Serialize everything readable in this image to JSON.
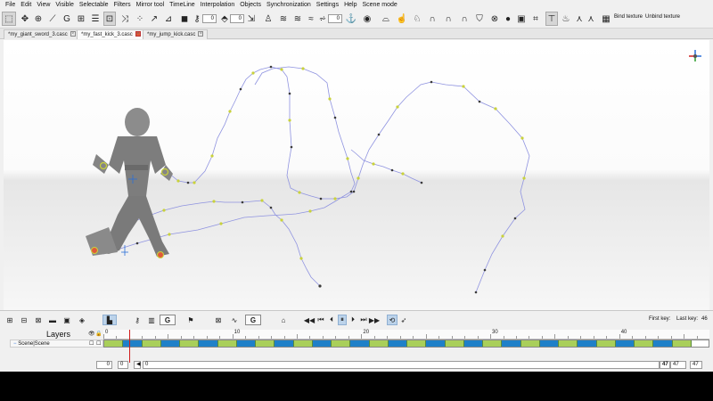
{
  "menu": [
    "File",
    "Edit",
    "View",
    "Visible",
    "Selectable",
    "Filters",
    "Mirror tool",
    "TimeLine",
    "Interpolation",
    "Objects",
    "Synchronization",
    "Settings",
    "Help",
    "Scene mode"
  ],
  "toolbar": {
    "field_a": "0",
    "field_b": "0",
    "field_c": "0",
    "bind_texture": "Bind texture",
    "unbind_texture": "Unbind texture"
  },
  "tabs": [
    {
      "label": "*my_giant_sword_3.casc",
      "active": false
    },
    {
      "label": "*my_fast_kick_3.casc",
      "active": true
    },
    {
      "label": "*my_jump_kick.casc",
      "active": false
    }
  ],
  "timeline": {
    "first_key_label": "First key:",
    "first_key_value": "",
    "last_key_label": "Last key:",
    "last_key_value": "46",
    "layers_title": "Layers",
    "layer_name": "Scene|Scene",
    "ruler_labels": [
      "0",
      "10",
      "20",
      "30",
      "40"
    ],
    "current_frame": 2,
    "frame_count": 47,
    "bottom_left_a": "0",
    "bottom_left_b": "0",
    "bottom_mid": "0",
    "bottom_right_a": "47",
    "bottom_right_b": "47",
    "bottom_right_c": "47",
    "g_label": "G",
    "key_segments": [
      "green",
      "blue",
      "green",
      "blue",
      "green",
      "blue",
      "green",
      "blue",
      "green",
      "blue",
      "green",
      "blue",
      "green",
      "blue",
      "green",
      "blue",
      "green",
      "blue",
      "green",
      "blue",
      "green",
      "blue",
      "green",
      "blue",
      "green",
      "blue",
      "green",
      "blue",
      "green",
      "blue",
      "green",
      "white"
    ]
  },
  "colors": {
    "key_green": "#a9cf5a",
    "key_blue": "#1f80c8",
    "curve_line": "#8f93e0",
    "keyframe_yellow": "#c9d23a",
    "keyframe_dark": "#3a3a3a",
    "playhead": "#d11a1a"
  },
  "icons": [
    "select-rect-icon",
    "move-icon",
    "rotate-icon",
    "scale-icon",
    "g-mode-icon",
    "snap-icon",
    "figure-icon",
    "joint-icon",
    "ik-icon",
    "cube-icon",
    "camera-icon",
    "light-icon",
    "grid-icon",
    "bind-icon"
  ]
}
